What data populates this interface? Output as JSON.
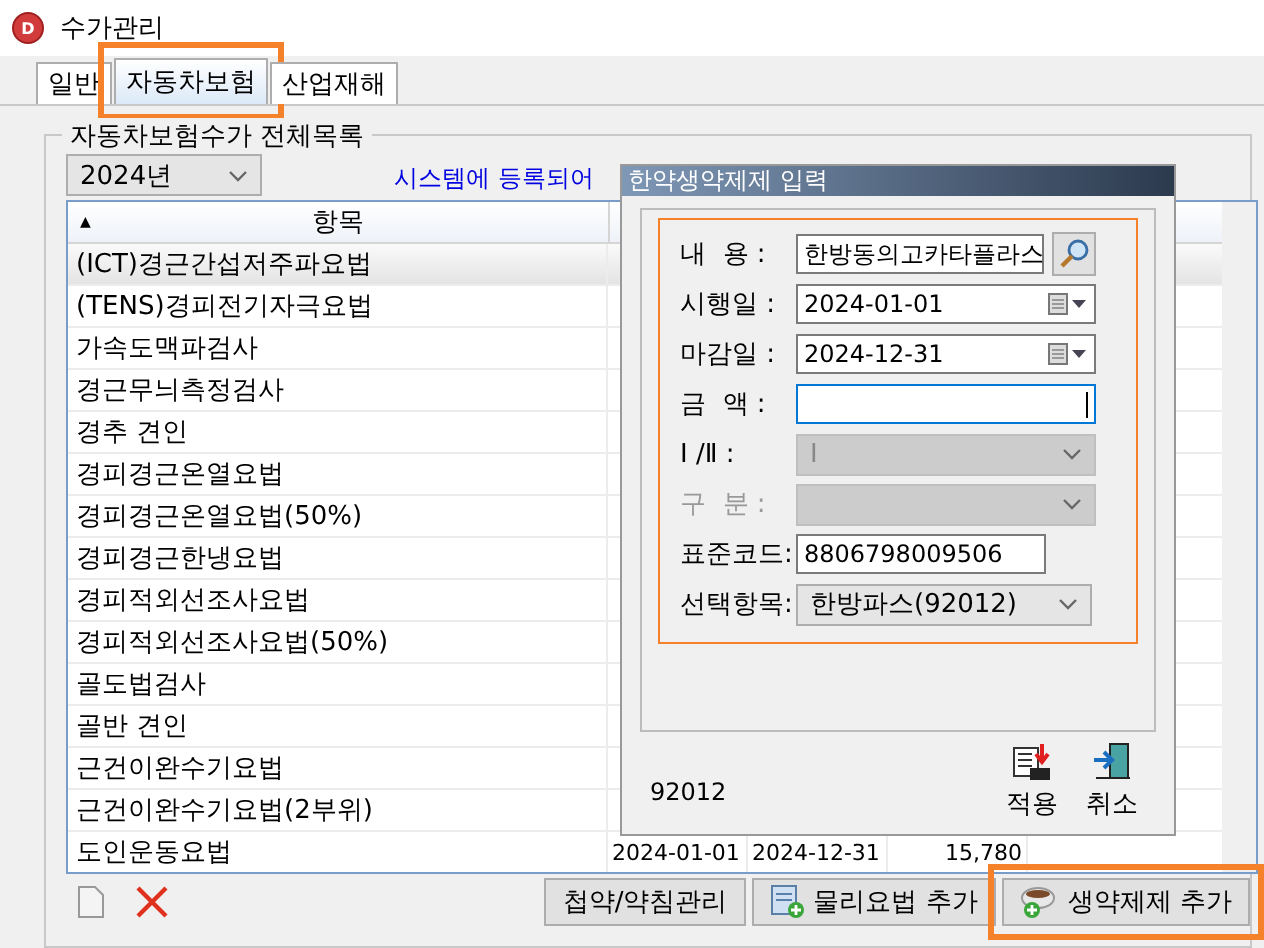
{
  "window": {
    "title": "수가관리",
    "icon_letter": "D"
  },
  "tabs": [
    {
      "label": "일반",
      "selected": false,
      "highlighted": false
    },
    {
      "label": "자동차보험",
      "selected": true,
      "highlighted": true
    },
    {
      "label": "산업재해",
      "selected": false,
      "highlighted": false
    }
  ],
  "group": {
    "title": "자동차보험수가 전체목록"
  },
  "year_select": {
    "value": "2024년"
  },
  "notice": "시스템에 등록되어",
  "table": {
    "columns": [
      {
        "label": "항목",
        "sort": "▲"
      }
    ],
    "rows": [
      {
        "name": "(ICT)경근간섭저주파요법",
        "selected": true
      },
      {
        "name": "(TENS)경피전기자극요법",
        "selected": false
      },
      {
        "name": "가속도맥파검사",
        "selected": false
      },
      {
        "name": "경근무늬측정검사",
        "selected": false
      },
      {
        "name": "경추 견인",
        "selected": false
      },
      {
        "name": "경피경근온열요법",
        "selected": false
      },
      {
        "name": "경피경근온열요법(50%)",
        "selected": false
      },
      {
        "name": "경피경근한냉요법",
        "selected": false
      },
      {
        "name": "경피적외선조사요법",
        "selected": false
      },
      {
        "name": "경피적외선조사요법(50%)",
        "selected": false
      },
      {
        "name": "골도법검사",
        "selected": false
      },
      {
        "name": "골반 견인",
        "selected": false
      },
      {
        "name": "근건이완수기요법",
        "selected": false
      },
      {
        "name": "근건이완수기요법(2부위)",
        "selected": false
      },
      {
        "name": "도인운동요법",
        "selected": false,
        "values": [
          "2024-01-01",
          "2024-12-31",
          "15,780"
        ]
      }
    ]
  },
  "buttons": [
    {
      "label": "첩약/약침관리",
      "kind": "plain",
      "highlighted": false
    },
    {
      "label": "물리요법 추가",
      "kind": "form",
      "highlighted": false
    },
    {
      "label": "생약제제 추가",
      "kind": "cup",
      "highlighted": true
    }
  ],
  "dialog": {
    "title": "한약생약제제 입력",
    "highlighted": true,
    "fields": [
      {
        "label": "내  용 :",
        "kind": "search",
        "value": "한방동의고카타플라스",
        "label_greyed": false
      },
      {
        "label": "시행일 :",
        "kind": "date",
        "value": "2024-01-01",
        "label_greyed": false
      },
      {
        "label": "마감일 :",
        "kind": "date",
        "value": "2024-12-31",
        "label_greyed": false
      },
      {
        "label": "금  액 :",
        "kind": "text",
        "focused": true,
        "label_greyed": false
      },
      {
        "label": "Ⅰ /Ⅱ :",
        "kind": "select",
        "value": "Ⅰ",
        "disabled": true,
        "label_greyed": false
      },
      {
        "label": "구  분 :",
        "kind": "select",
        "disabled": true,
        "label_greyed": true
      },
      {
        "label": "표준코드:",
        "kind": "text",
        "value": "8806798009506",
        "focused": false,
        "label_greyed": false
      },
      {
        "label": "선택항목:",
        "kind": "select",
        "value": "한방파스(92012)",
        "disabled": false,
        "label_greyed": false
      }
    ],
    "code": "92012",
    "actions": [
      {
        "label": "적용",
        "kind": "apply"
      },
      {
        "label": "취소",
        "kind": "cancel"
      }
    ]
  }
}
